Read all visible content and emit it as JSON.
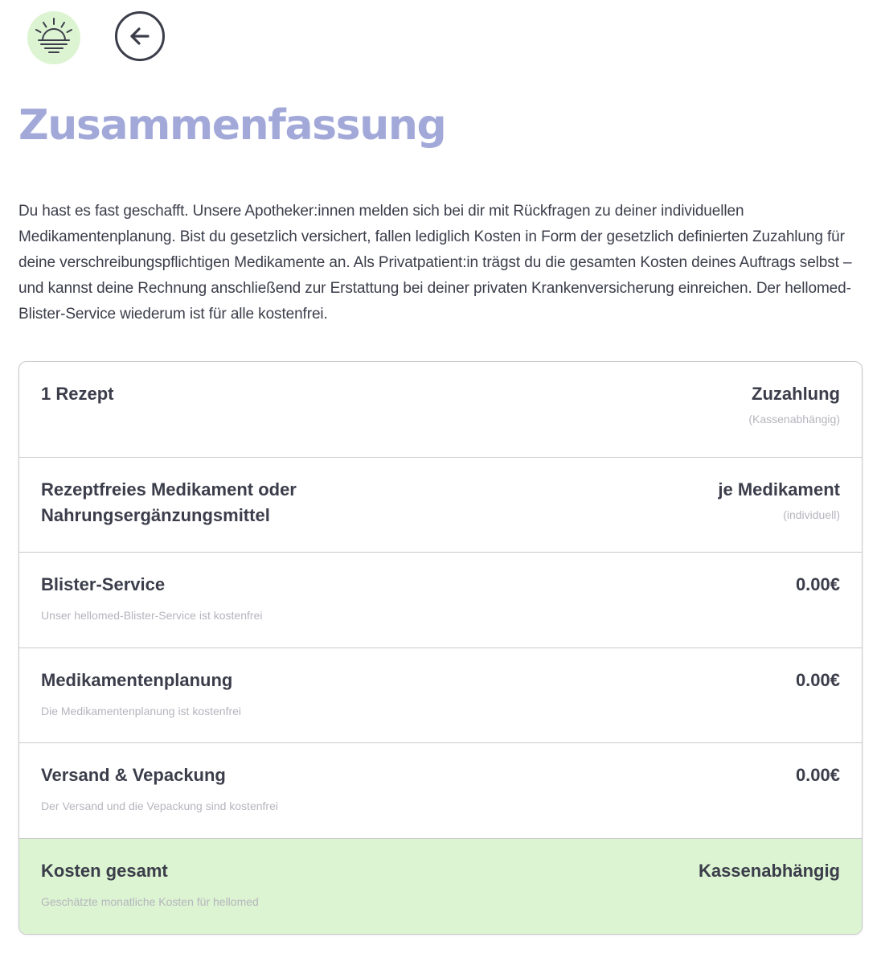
{
  "header": {
    "logo_icon": "sunrise-icon",
    "back_icon": "arrow-left-icon",
    "logo_bg_color": "#dcf4d2"
  },
  "page": {
    "title": "Zusammenfassung",
    "title_color": "#a2a9d9",
    "intro": "Du hast es fast geschafft. Unsere Apotheker:innen melden sich bei dir mit Rückfragen zu deiner individuellen Medikamentenplanung. Bist du gesetzlich versichert, fallen lediglich Kosten in Form der gesetzlich definierten Zuzahlung für deine verschreibungspflichtigen Medikamente an. Als Privatpatient:in trägst du die gesamten Kosten deines Auftrags selbst – und kannst deine Rechnung anschließend zur Erstattung bei deiner privaten Krankenversicherung einreichen. Der hellomed-Blister-Service wiederum ist für alle kostenfrei."
  },
  "summary": {
    "rows": [
      {
        "title": "1 Rezept",
        "value": "Zuzahlung",
        "value_note": "(Kassenabhängig)"
      },
      {
        "title": "Rezeptfreies Medikament oder Nahrungsergänzungsmittel",
        "value": "je Medikament",
        "value_note": "(individuell)"
      },
      {
        "title": "Blister-Service",
        "subtitle": "Unser hellomed-Blister-Service ist kostenfrei",
        "value": "0.00€"
      },
      {
        "title": "Medikamentenplanung",
        "subtitle": "Die Medikamentenplanung ist kostenfrei",
        "value": "0.00€"
      },
      {
        "title": "Versand & Vepackung",
        "subtitle": "Der Versand und die Vepackung sind kostenfrei",
        "value": "0.00€"
      }
    ],
    "total": {
      "title": "Kosten gesamt",
      "subtitle": "Geschätzte monatliche Kosten für hellomed",
      "value": "Kassenabhängig",
      "bg_color": "#dcf4d2"
    }
  }
}
